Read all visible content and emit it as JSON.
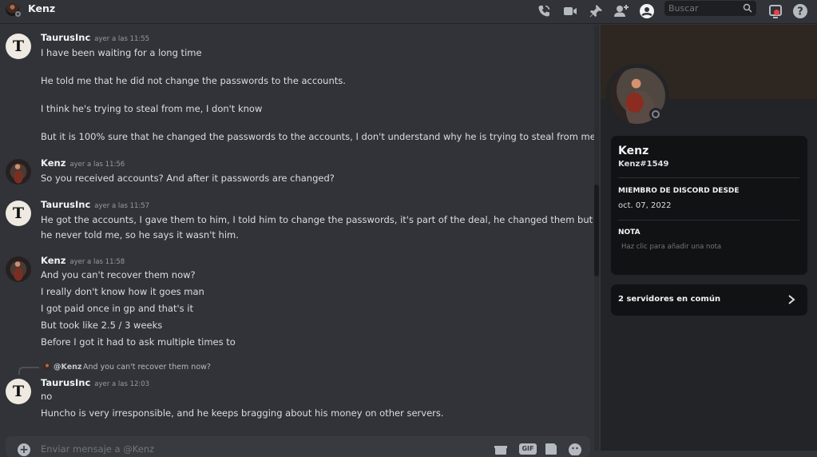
{
  "header": {
    "title": "Kenz",
    "search_placeholder": "Buscar"
  },
  "messages": [
    {
      "author": "TaurusInc",
      "time": "ayer a las 11:55",
      "avatar_letter": "T",
      "lines": [
        "I have been waiting for a long time",
        "He told me that he did not change the passwords to the accounts.",
        "I think he's trying to steal from me, I don't know",
        "But it is 100% sure that he changed the passwords to the accounts, I don't understand why he is trying to steal from me."
      ]
    },
    {
      "author": "Kenz",
      "time": "ayer a las 11:56",
      "lines": [
        "So you received accounts? And after it passwords are changed?"
      ]
    },
    {
      "author": "TaurusInc",
      "time": "ayer a las 11:57",
      "avatar_letter": "T",
      "lines": [
        "He got the accounts, I gave them to him, I told him to change the passwords, it's part of the deal, he changed them but",
        "he never told me, so he says it wasn't him."
      ]
    },
    {
      "author": "Kenz",
      "time": "ayer a las 11:58",
      "lines": [
        "And you can't recover them now?",
        "I really don't know how it goes man",
        "I got paid once in gp and that's it",
        "But took like 2.5 / 3 weeks",
        "Before I got it had to ask multiple times to"
      ]
    },
    {
      "author": "TaurusInc",
      "time": "ayer a las 12:03",
      "avatar_letter": "T",
      "reply": {
        "user": "@Kenz",
        "text": "And you can't recover them now?"
      },
      "lines": [
        "no",
        "Huncho is very irresponsible, and he keeps bragging about his money on other servers."
      ]
    }
  ],
  "composer": {
    "placeholder": "Enviar mensaje a @Kenz",
    "gif_label": "GIF"
  },
  "profile": {
    "name": "Kenz",
    "tag": "Kenz#1549",
    "member_since_title": "MIEMBRO DE DISCORD DESDE",
    "member_since": "oct. 07, 2022",
    "note_title": "NOTA",
    "note_placeholder": "Haz clic para añadir una nota",
    "mutual_servers": "2 servidores en común"
  },
  "colors": {
    "background": "#313338",
    "sidebar": "#232428",
    "card": "#111214",
    "notification": "#f23f43"
  }
}
